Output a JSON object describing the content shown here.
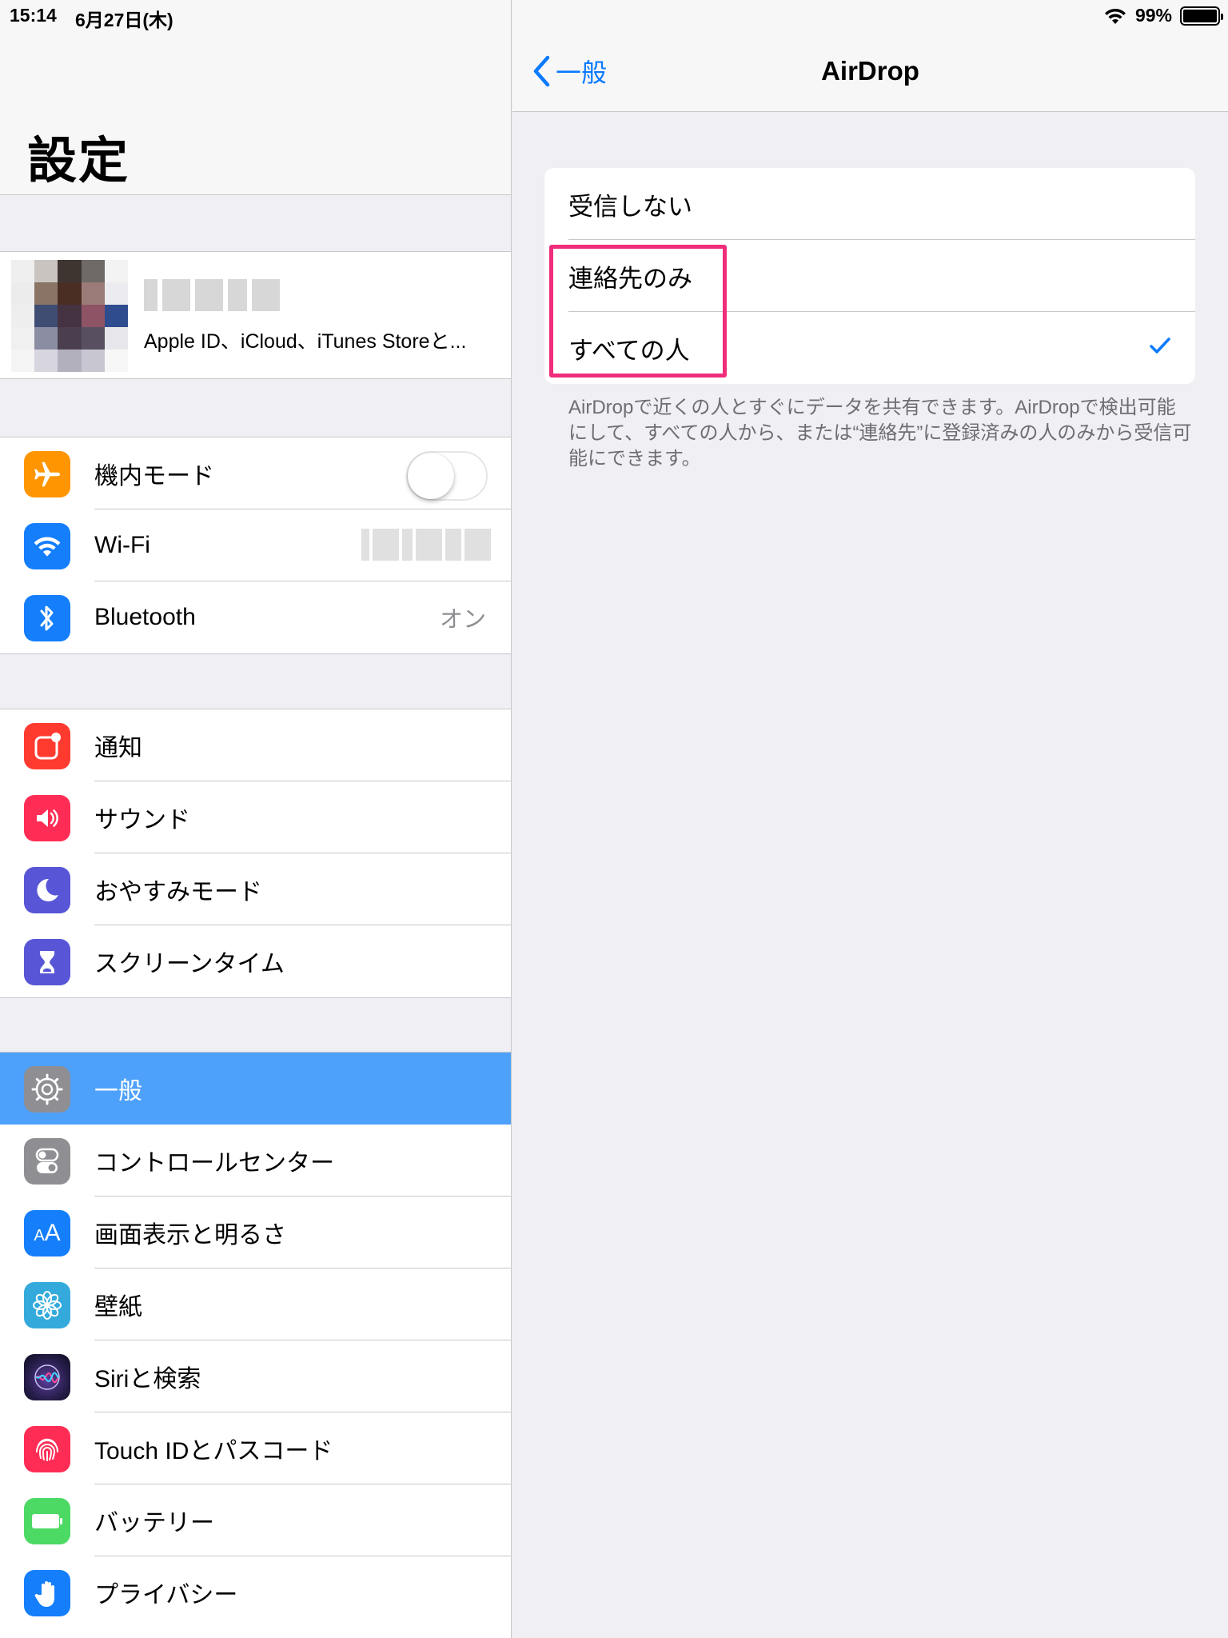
{
  "status_bar": {
    "time": "15:14",
    "date": "6月27日(木)",
    "battery": "99%"
  },
  "left": {
    "title": "設定",
    "profile": {
      "subtitle": "Apple ID、iCloud、iTunes Storeと..."
    },
    "group1": [
      {
        "label": "機内モード",
        "icon": "airplane-icon",
        "color": "#ff9500",
        "toggle": false
      },
      {
        "label": "Wi-Fi",
        "icon": "wifi-icon",
        "color": "#147efb"
      },
      {
        "label": "Bluetooth",
        "icon": "bluetooth-icon",
        "color": "#147efb",
        "value": "オン"
      }
    ],
    "group2": [
      {
        "label": "通知",
        "icon": "notifications-icon",
        "color": "#ff3b30"
      },
      {
        "label": "サウンド",
        "icon": "speaker-icon",
        "color": "#ff2d55"
      },
      {
        "label": "おやすみモード",
        "icon": "moon-icon",
        "color": "#5856d6"
      },
      {
        "label": "スクリーンタイム",
        "icon": "hourglass-icon",
        "color": "#5856d6"
      }
    ],
    "group3": [
      {
        "label": "一般",
        "icon": "gear-icon",
        "color": "#8e8e93",
        "selected": true
      },
      {
        "label": "コントロールセンター",
        "icon": "switches-icon",
        "color": "#8e8e93"
      },
      {
        "label": "画面表示と明るさ",
        "icon": "text-size-icon",
        "color": "#147efb"
      },
      {
        "label": "壁紙",
        "icon": "flower-icon",
        "color": "#34aadc"
      },
      {
        "label": "Siriと検索",
        "icon": "siri-icon",
        "color": "#1c1c3a"
      },
      {
        "label": "Touch IDとパスコード",
        "icon": "fingerprint-icon",
        "color": "#ff2d55"
      },
      {
        "label": "バッテリー",
        "icon": "battery-icon",
        "color": "#4cd964"
      },
      {
        "label": "プライバシー",
        "icon": "hand-icon",
        "color": "#147efb"
      }
    ]
  },
  "right": {
    "back_label": "一般",
    "title": "AirDrop",
    "options": [
      {
        "label": "受信しない",
        "checked": false
      },
      {
        "label": "連絡先のみ",
        "checked": false
      },
      {
        "label": "すべての人",
        "checked": true
      }
    ],
    "footnote": "AirDropで近くの人とすぐにデータを共有できます。AirDropで検出可能にして、すべての人から、または“連絡先”に登録済みの人のみから受信可能にできます。",
    "accent": "#0a7aff",
    "highlight_color": "#ef2d7a"
  }
}
